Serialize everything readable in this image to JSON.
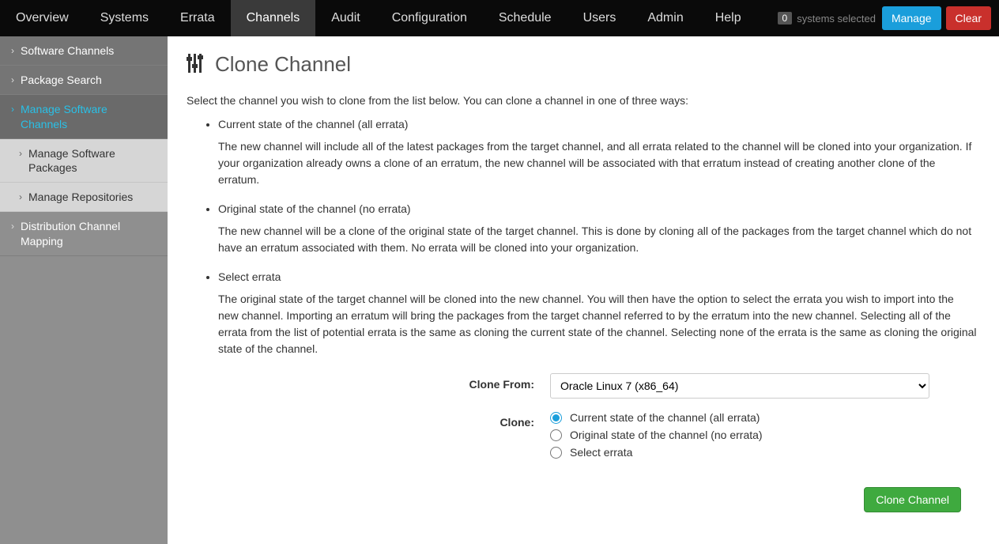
{
  "topnav": {
    "items": [
      "Overview",
      "Systems",
      "Errata",
      "Channels",
      "Audit",
      "Configuration",
      "Schedule",
      "Users",
      "Admin",
      "Help"
    ],
    "active_index": 3,
    "systems_count": "0",
    "systems_label": "systems selected",
    "manage_label": "Manage",
    "clear_label": "Clear"
  },
  "sidebar": {
    "items": [
      {
        "label": "Software Channels",
        "type": "item",
        "dark": true
      },
      {
        "label": "Package Search",
        "type": "item",
        "dark": true
      },
      {
        "label": "Manage Software Channels",
        "type": "item",
        "active": true
      },
      {
        "label": "Manage Software Packages",
        "type": "sub"
      },
      {
        "label": "Manage Repositories",
        "type": "sub"
      },
      {
        "label": "Distribution Channel Mapping",
        "type": "item"
      }
    ]
  },
  "page": {
    "title": "Clone Channel",
    "intro": "Select the channel you wish to clone from the list below. You can clone a channel in one of three ways:",
    "ways": [
      {
        "title": "Current state of the channel (all errata)",
        "desc": "The new channel will include all of the latest packages from the target channel, and all errata related to the channel will be cloned into your organization. If your organization already owns a clone of an erratum, the new channel will be associated with that erratum instead of creating another clone of the erratum."
      },
      {
        "title": "Original state of the channel (no errata)",
        "desc": "The new channel will be a clone of the original state of the target channel. This is done by cloning all of the packages from the target channel which do not have an erratum associated with them. No errata will be cloned into your organization."
      },
      {
        "title": "Select errata",
        "desc": "The original state of the target channel will be cloned into the new channel. You will then have the option to select the errata you wish to import into the new channel. Importing an erratum will bring the packages from the target channel referred to by the erratum into the new channel. Selecting all of the errata from the list of potential errata is the same as cloning the current state of the channel. Selecting none of the errata is the same as cloning the original state of the channel."
      }
    ],
    "form": {
      "clone_from_label": "Clone From:",
      "clone_from_value": "Oracle Linux 7 (x86_64)",
      "clone_label": "Clone:",
      "radios": [
        "Current state of the channel (all errata)",
        "Original state of the channel (no errata)",
        "Select errata"
      ],
      "selected_radio_index": 0,
      "submit_label": "Clone Channel"
    }
  }
}
